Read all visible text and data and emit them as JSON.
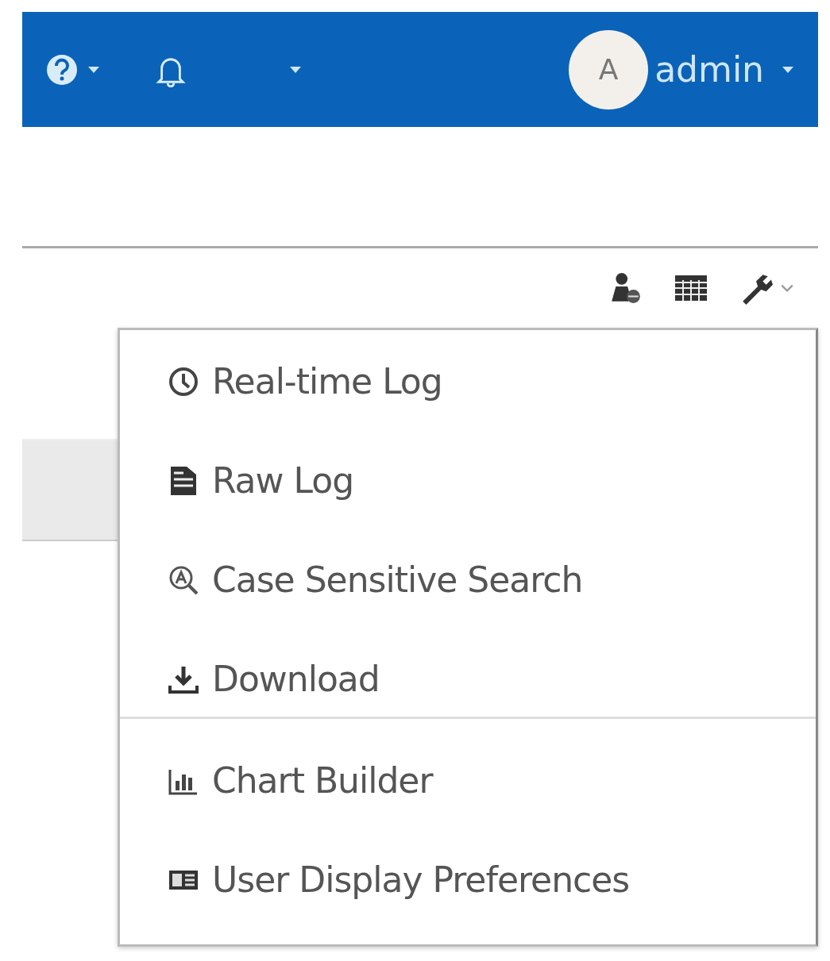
{
  "header": {
    "avatar_initial": "A",
    "username": "admin"
  },
  "menu": {
    "groups": [
      {
        "items": [
          {
            "kind": "clock",
            "label": "Real-time Log"
          },
          {
            "kind": "document",
            "label": "Raw Log"
          },
          {
            "kind": "search",
            "label": "Case Sensitive Search"
          },
          {
            "kind": "download",
            "label": "Download"
          }
        ]
      },
      {
        "items": [
          {
            "kind": "chart",
            "label": "Chart Builder"
          },
          {
            "kind": "preferences",
            "label": "User Display Preferences"
          }
        ]
      }
    ]
  }
}
